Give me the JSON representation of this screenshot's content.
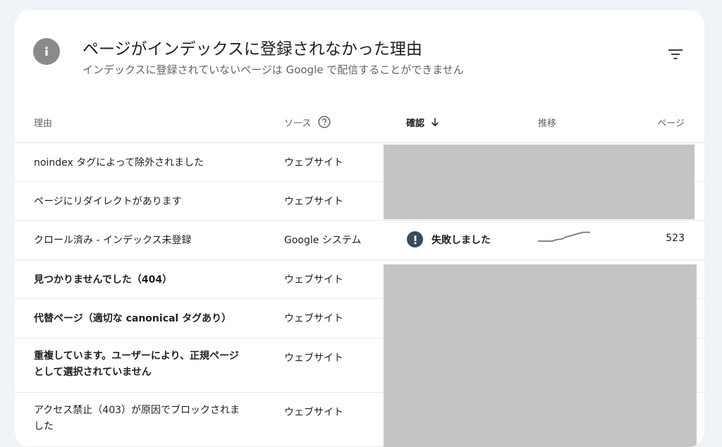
{
  "header": {
    "title": "ページがインデックスに登録されなかった理由",
    "subtitle": "インデックスに登録されていないページは Google で配信することができません"
  },
  "table": {
    "columns": {
      "reason": "理由",
      "source": "ソース",
      "confirmation": "確認",
      "trend": "推移",
      "pages": "ページ"
    },
    "rows": [
      {
        "reason": "noindex タグによって除外されました",
        "source": "ウェブサイト"
      },
      {
        "reason": "ページにリダイレクトがあります",
        "source": "ウェブサイト"
      },
      {
        "reason": "クロール済み - インデックス未登録",
        "source": "Google システム",
        "status": "失敗しました",
        "pages": "523"
      },
      {
        "reason": "見つかりませんでした（404）",
        "source": "ウェブサイト"
      },
      {
        "reason": "代替ページ（適切な canonical タグあり）",
        "source": "ウェブサイト"
      },
      {
        "reason": "重複しています。ユーザーにより、正規ページとして選択されていません",
        "source": "ウェブサイト"
      },
      {
        "reason": "アクセス禁止（403）が原因でブロックされました",
        "source": "ウェブサイト"
      }
    ]
  },
  "icons": {
    "info": "info-icon",
    "filter": "filter-icon",
    "help": "help-icon",
    "sort": "arrow-down-icon",
    "error": "exclamation-icon"
  },
  "colors": {
    "redaction": "#c4c4c4",
    "error_icon": "#3c4a56",
    "info_icon": "#8a8a8a"
  }
}
